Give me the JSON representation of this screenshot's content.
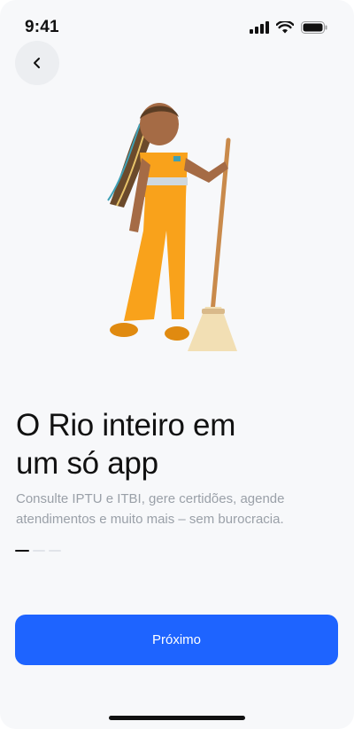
{
  "status_bar": {
    "time": "9:41",
    "icons": [
      "signal-icon",
      "wifi-icon",
      "battery-icon"
    ]
  },
  "nav": {
    "back_icon": "chevron-left-icon"
  },
  "illustration": {
    "name": "street-sweeper-character",
    "accent": "#f5a623"
  },
  "onboarding": {
    "headline_line1": "O Rio inteiro em",
    "headline_line2": "um só app",
    "subtitle": "Consulte IPTU e ITBI, gere certidões, agende atendimentos e muito mais – sem burocracia.",
    "page_current": 1,
    "page_total": 3
  },
  "actions": {
    "next_label": "Próximo"
  },
  "colors": {
    "primary": "#1e64ff",
    "text": "#111111",
    "muted": "#9aa0a8"
  }
}
